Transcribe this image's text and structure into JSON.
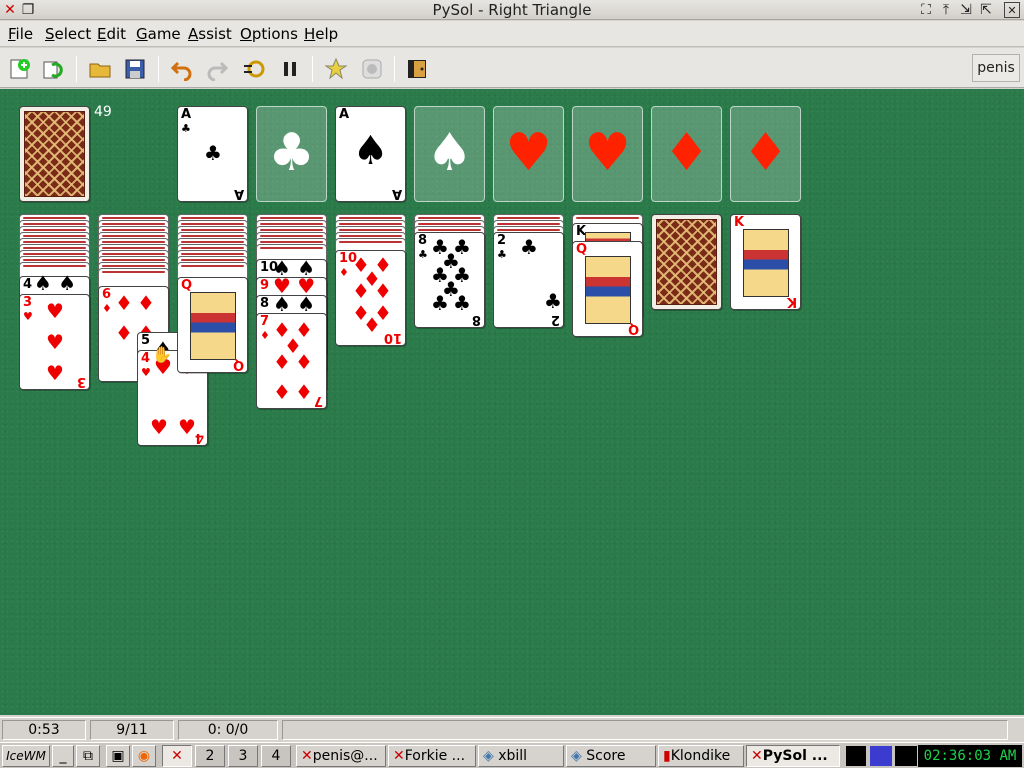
{
  "window": {
    "title": "PySol - Right Triangle"
  },
  "menu": [
    {
      "label": "File",
      "u": "F",
      "rest": "ile"
    },
    {
      "label": "Select",
      "u": "S",
      "rest": "elect"
    },
    {
      "label": "Edit",
      "u": "E",
      "rest": "dit"
    },
    {
      "label": "Game",
      "u": "G",
      "rest": "ame"
    },
    {
      "label": "Assist",
      "u": "A",
      "rest": "ssist"
    },
    {
      "label": "Options",
      "u": "O",
      "rest": "ptions"
    },
    {
      "label": "Help",
      "u": "H",
      "rest": "elp"
    }
  ],
  "toolbar": {
    "player": "penis"
  },
  "stock": {
    "count": "49"
  },
  "cards": {
    "f1": {
      "rank": "A",
      "suit": "♣"
    },
    "f3": {
      "rank": "A",
      "suit": "♠"
    },
    "r4_top": {
      "rank": "4"
    },
    "r3": {
      "rank": "3",
      "suit": "♥"
    },
    "r6": {
      "rank": "6",
      "suit": "♦"
    },
    "r5": {
      "rank": "5"
    },
    "r4h": {
      "rank": "4",
      "suit": "♥"
    },
    "q_hearts": {
      "rank": "Q"
    },
    "r10_top": {
      "rank": "10"
    },
    "r9": {
      "rank": "9"
    },
    "r8_top": {
      "rank": "8"
    },
    "r7": {
      "rank": "7",
      "suit": "♦"
    },
    "r10d": {
      "rank": "10",
      "suit": "♦"
    },
    "r8c": {
      "rank": "8",
      "suit": "♣"
    },
    "r2c": {
      "rank": "2",
      "suit": "♣"
    },
    "k_top": {
      "rank": "K"
    },
    "q_red": {
      "rank": "Q"
    },
    "k_hearts": {
      "rank": "K"
    }
  },
  "status": {
    "time": "0:53",
    "progress": "9/11",
    "score": "0: 0/0"
  },
  "taskbar": {
    "desktops": [
      "2",
      "3",
      "4"
    ],
    "tasks": [
      "penis@...",
      "Forkie ...",
      "xbill",
      "Score",
      "Klondike",
      "PySol ..."
    ],
    "clock": "02:36:03 AM"
  },
  "colors": {
    "felt": "#2a7a4a",
    "red_suit": "#ee0000",
    "clock_text": "#1dd24a"
  }
}
